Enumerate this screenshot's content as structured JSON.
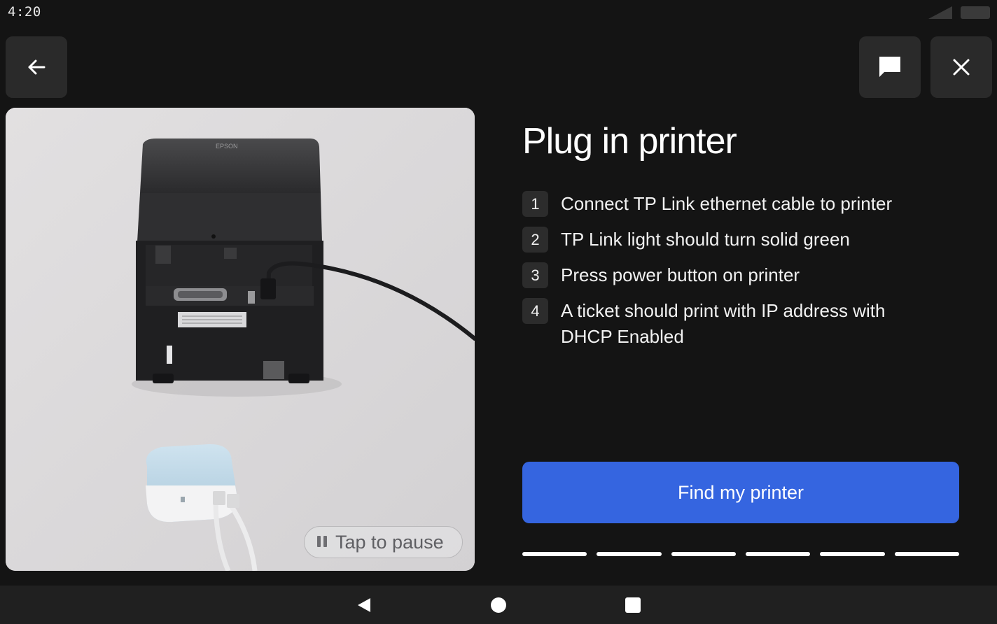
{
  "status_bar": {
    "time": "4:20",
    "icons": [
      "signal-icon",
      "battery-icon"
    ]
  },
  "header": {
    "back_icon": "arrow-left-icon",
    "chat_icon": "chat-bubble-icon",
    "close_icon": "close-icon"
  },
  "media": {
    "image_subject": "Epson receipt printer connected by ethernet cable to a TP Link mini router",
    "printer_brand": "EPSON",
    "pause_label": "Tap to pause",
    "pause_icon": "pause-icon"
  },
  "content": {
    "title": "Plug in printer",
    "steps": [
      {
        "num": "1",
        "text": "Connect TP Link ethernet cable to printer"
      },
      {
        "num": "2",
        "text": "TP Link light should turn solid green"
      },
      {
        "num": "3",
        "text": "Press power button on printer"
      },
      {
        "num": "4",
        "text": "A ticket should print with IP address with DHCP Enabled"
      }
    ],
    "primary_button": "Find my printer",
    "progress_segments": 6
  },
  "nav_bar": {
    "icons": [
      "nav-back-icon",
      "nav-home-icon",
      "nav-recents-icon"
    ]
  },
  "colors": {
    "background": "#141414",
    "button_surface": "#2a2a2a",
    "accent": "#3565e0",
    "nav_bar": "#202020"
  }
}
